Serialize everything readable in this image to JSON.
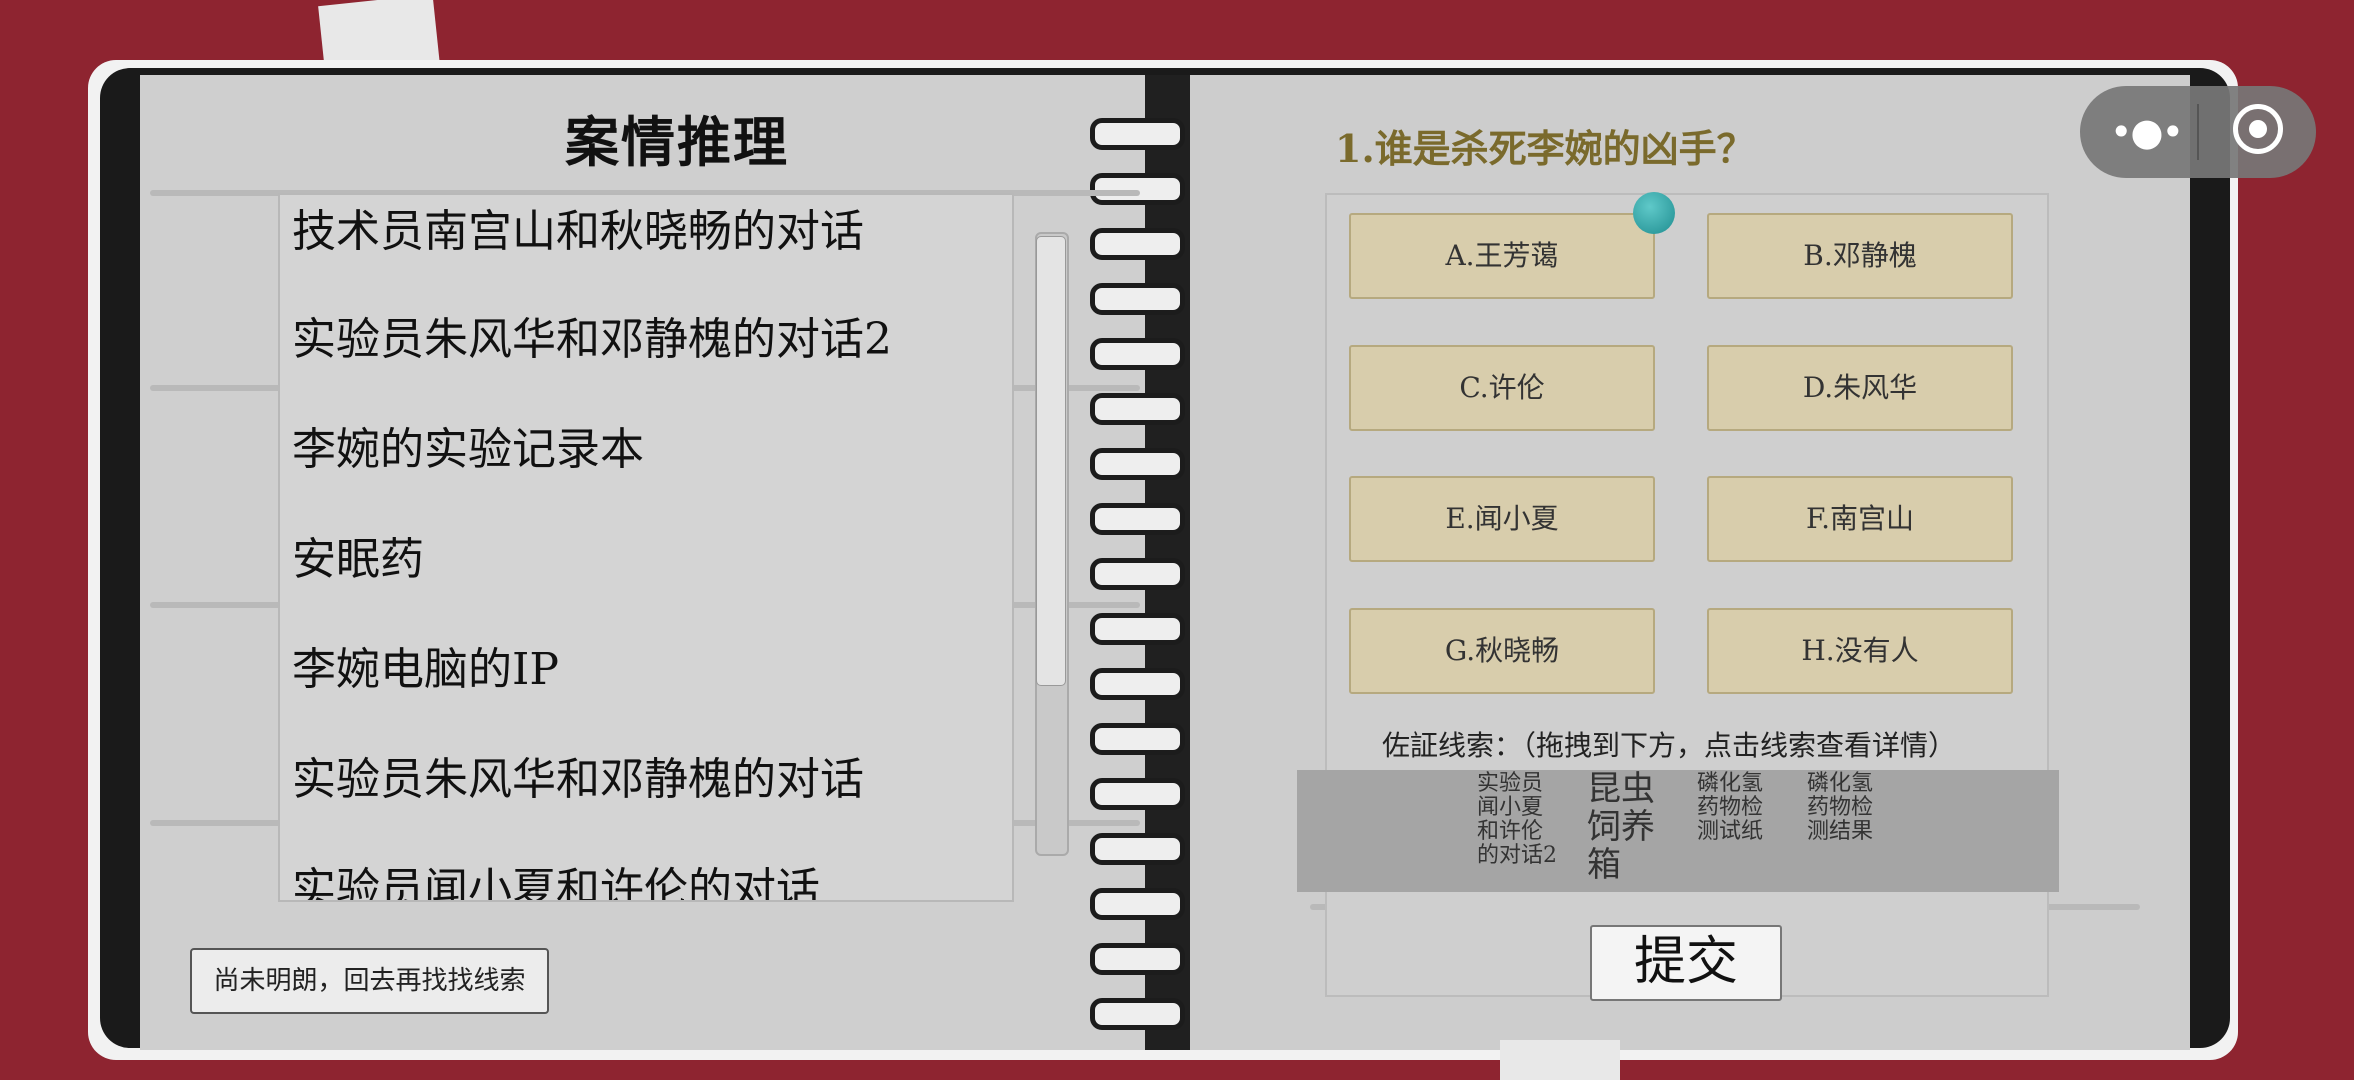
{
  "left_page": {
    "title": "案情推理",
    "clue_list": [
      "技术员南宫山和秋晓畅的对话",
      "实验员朱风华和邓静槐的对话2",
      "李婉的实验记录本",
      "安眠药",
      "李婉电脑的IP",
      "实验员朱风华和邓静槐的对话",
      "实验员闻小夏和许伦的对话"
    ],
    "back_button": "尚未明朗，回去再找找线索"
  },
  "right_page": {
    "question": "1.谁是杀死李婉的凶手？",
    "options": [
      "A.王芳蔼",
      "B.邓静槐",
      "C.许伦",
      "D.朱风华",
      "E.闻小夏",
      "F.南宫山",
      "G.秋晓畅",
      "H.没有人"
    ],
    "evidence_label": "佐証线索：（拖拽到下方，点击线索查看详情）",
    "evidence_items": [
      "实验员闻小夏和许伦的对话2",
      "昆虫饲养箱",
      "磷化氢药物检测试纸",
      "磷化氢药物检测结果"
    ],
    "submit_button": "提交"
  },
  "capsule": {
    "menu_icon": "more-dots-icon",
    "close_icon": "target-close-icon"
  },
  "colors": {
    "background": "#8e2430",
    "option_fill": "#d8cdac",
    "question_text": "#7a6a2c",
    "accent_dot": "#2f9fa2"
  }
}
